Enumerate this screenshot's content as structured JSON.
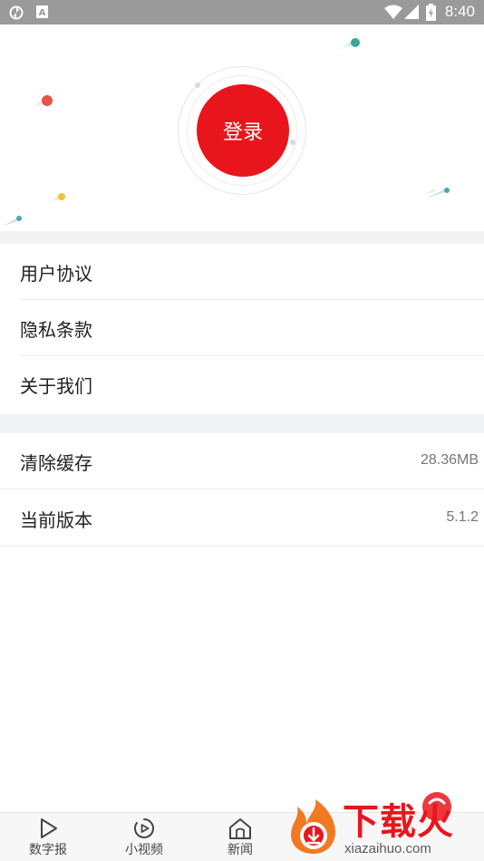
{
  "status_bar": {
    "time": "8:40"
  },
  "hero": {
    "login_label": "登录"
  },
  "menu_group_1": [
    {
      "label": "用户协议"
    },
    {
      "label": "隐私条款"
    },
    {
      "label": "关于我们"
    }
  ],
  "menu_group_2": [
    {
      "label": "清除缓存",
      "value": "28.36MB"
    },
    {
      "label": "当前版本",
      "value": "5.1.2"
    }
  ],
  "tabbar": {
    "tabs": [
      {
        "label": "数字报",
        "icon": "play-triangle-icon"
      },
      {
        "label": "小视频",
        "icon": "video-circle-icon"
      },
      {
        "label": "新闻",
        "icon": "home-icon"
      }
    ]
  },
  "watermark": {
    "brand": "下载火",
    "url": "xiazaihuo.com"
  },
  "colors": {
    "accent": "#e8161c",
    "status_bar": "#9a9a9a",
    "section_gap": "#f2f3f5"
  }
}
